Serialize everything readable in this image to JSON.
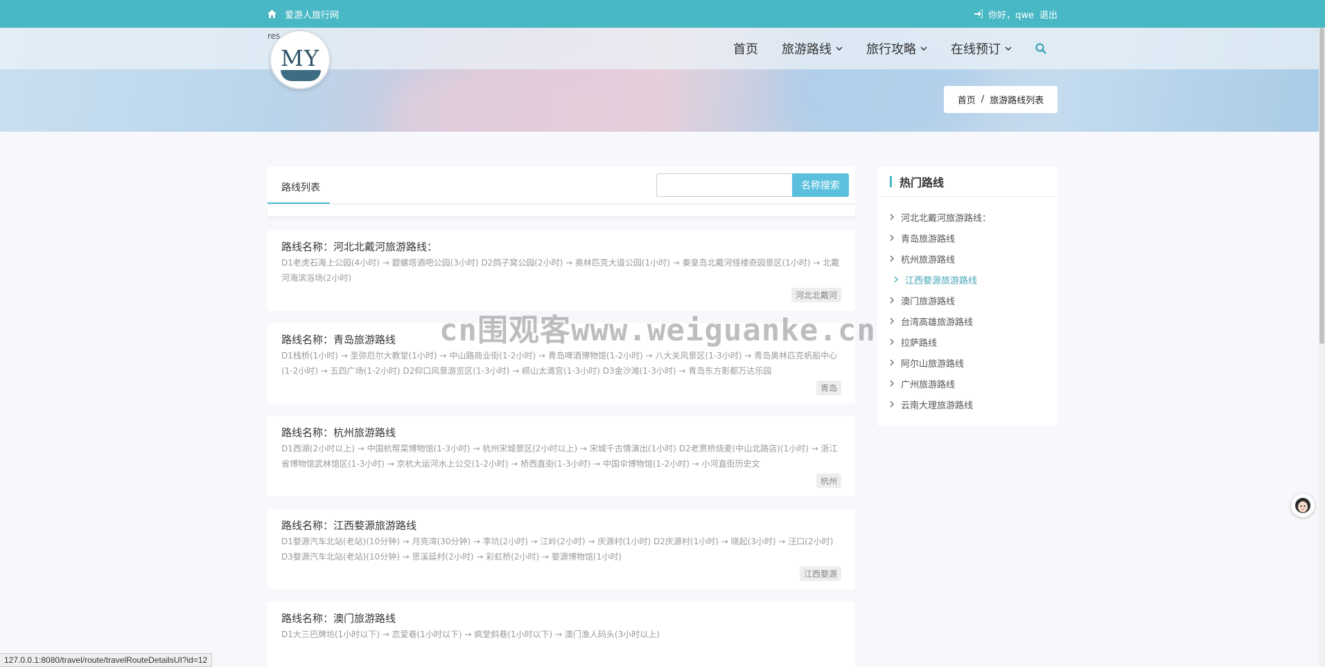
{
  "topbar": {
    "site_name": "爱游人旅行网",
    "greeting": "你好，qwe",
    "logout": "退出"
  },
  "logo": {
    "text": "MY",
    "res_label": "res"
  },
  "nav": {
    "home": "首页",
    "routes": "旅游路线",
    "guides": "旅行攻略",
    "booking": "在线预订"
  },
  "breadcrumb": {
    "home": "首页",
    "sep": "/",
    "current": "旅游路线列表"
  },
  "list": {
    "tab": "路线列表",
    "search_placeholder": "",
    "search_button": "名称搜索",
    "title_prefix": "路线名称：",
    "routes": [
      {
        "name": "河北北戴河旅游路线：",
        "desc": "D1老虎石海上公园(4小时) → 碧螺塔酒吧公园(3小时) D2鸽子窝公园(2小时) → 奥林匹克大道公园(1小时) → 秦皇岛北戴河怪楼奇园景区(1小时) → 北戴河海滨浴场(2小时)",
        "tag": "河北北戴河"
      },
      {
        "name": "青岛旅游路线",
        "desc": "D1栈桥(1小时) → 圣弥厄尔大教堂(1小时) → 中山路商业街(1-2小时) → 青岛啤酒博物馆(1-2小时) → 八大关风景区(1-3小时) → 青岛奥林匹克帆船中心(1-2小时) → 五四广场(1-2小时) D2仰口风景游览区(1-3小时) → 崂山太清宫(1-3小时) D3金沙滩(1-3小时) → 青岛东方影都万达乐园",
        "tag": "青岛"
      },
      {
        "name": "杭州旅游路线",
        "desc": "D1西湖(2小时以上) → 中国杭帮菜博物馆(1-3小时) → 杭州宋城景区(2小时以上) → 宋城千古情演出(1小时) D2老贯桥烧麦(中山北路店)(1小时) → 浙江省博物馆武林馆区(1-3小时) → 京杭大运河水上公交(1-2小时) → 桥西直街(1-3小时) → 中国伞博物馆(1-2小时) → 小河直街历史文",
        "tag": "杭州"
      },
      {
        "name": "江西婺源旅游路线",
        "desc": "D1婺源汽车北站(老站)(10分钟) → 月亮湾(30分钟) → 李坑(2小时) → 江岭(2小时) → 庆源村(1小时) D2庆源村(1小时) → 晓起(3小时) → 汪口(2小时) D3婺源汽车北站(老站)(10分钟) → 思溪延村(2小时) → 彩虹桥(2小时) → 婺源博物馆(1小时)",
        "tag": "江西婺源"
      },
      {
        "name": "澳门旅游路线",
        "desc": "D1大三巴牌坊(1小时以下) → 恋爱巷(1小时以下) → 疯堂斜巷(1小时以下) → 澳门渔人码头(3小时以上)",
        "tag": ""
      }
    ]
  },
  "sidebar": {
    "title": "热门路线",
    "items": [
      "河北北戴河旅游路线：",
      "青岛旅游路线",
      "杭州旅游路线",
      "江西婺源旅游路线",
      "澳门旅游路线",
      "台湾高雄旅游路线",
      "拉萨路线",
      "阿尔山旅游路线",
      "广州旅游路线",
      "云南大理旅游路线"
    ],
    "highlight_index": 3
  },
  "watermark": "cn围观客www.weiguanke.cn",
  "statusbar": {
    "url": "127.0.0.1:8080/travel/route/travelRouteDetailsUI?id=12"
  },
  "colors": {
    "accent": "#47b8c4",
    "search_button": "#5bc0de"
  },
  "icons": {
    "home": "home-icon",
    "login": "sign-in-icon",
    "search": "search-icon",
    "chevron": "chevron-down-icon",
    "arrow": "chevron-right-icon"
  }
}
